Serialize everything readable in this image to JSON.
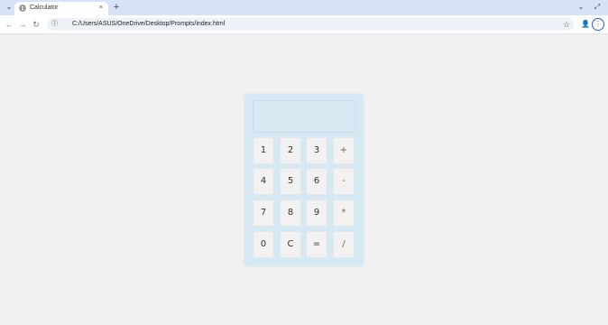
{
  "browser": {
    "tab_menu_icon": "chevron-down-icon",
    "tab_title": "Calculator",
    "tab_close": "×",
    "new_tab": "+",
    "window_minimize": "⌄",
    "window_more": "⤢",
    "back": "←",
    "forward": "→",
    "reload": "↻",
    "site_info": "ⓘ",
    "url": "C:/Users/ASUS/OneDrive/Desktop/Prompts/index.html",
    "bookmark": "☆",
    "profile": "👤",
    "menu": "⋮"
  },
  "calculator": {
    "display_value": "",
    "keys": [
      [
        "1",
        "2",
        "3",
        "+"
      ],
      [
        "4",
        "5",
        "6",
        "-"
      ],
      [
        "7",
        "8",
        "9",
        "*"
      ],
      [
        "0",
        "C",
        "=",
        "/"
      ]
    ]
  },
  "colors": {
    "page_background": "#f1f1f1",
    "calculator_background": "#d5e9f5",
    "key_background": "#f2f2f2",
    "accent": "#2a5bd7"
  }
}
